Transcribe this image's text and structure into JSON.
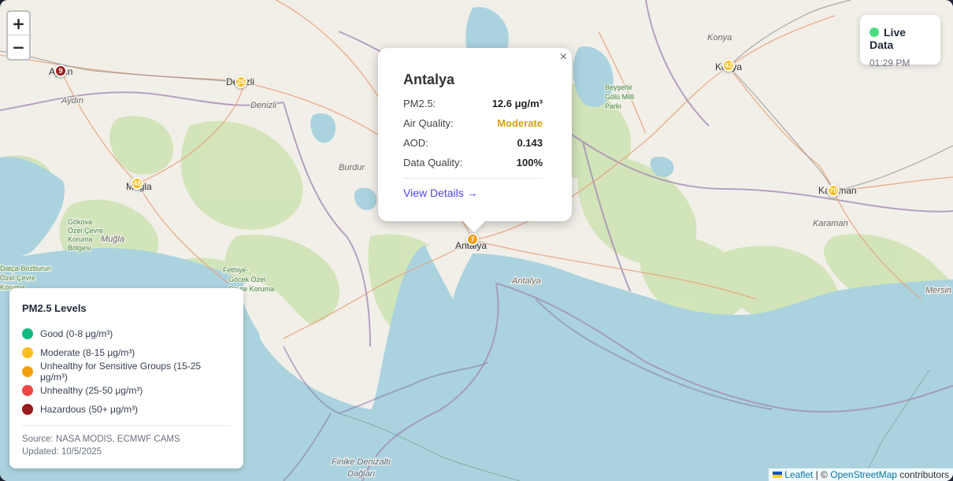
{
  "map": {
    "place_labels": [
      {
        "text": "Aydın",
        "size": 12,
        "color": "#333"
      },
      {
        "text": "Aydın",
        "size": 11,
        "color": "#6b6b6b",
        "italic": true
      },
      {
        "text": "Denizli",
        "size": 12,
        "color": "#333"
      },
      {
        "text": "Denizli",
        "size": 11,
        "color": "#6b6b6b",
        "italic": true
      },
      {
        "text": "Konya",
        "size": 11,
        "color": "#6b6b6b",
        "italic": true
      },
      {
        "text": "Konya",
        "size": 12,
        "color": "#333"
      },
      {
        "text": "Beyşehir",
        "size": 9,
        "color": "#3f8a3f"
      },
      {
        "text": "Gölü Milli",
        "size": 9,
        "color": "#3f8a3f"
      },
      {
        "text": "Parkı",
        "size": 9,
        "color": "#3f8a3f"
      },
      {
        "text": "Burdur",
        "size": 11,
        "color": "#6b6b6b",
        "italic": true
      },
      {
        "text": "Muğla",
        "size": 12,
        "color": "#333"
      },
      {
        "text": "Muğla",
        "size": 11,
        "color": "#6b6b6b",
        "italic": true
      },
      {
        "text": "Gökova",
        "size": 9,
        "color": "#3f8a3f"
      },
      {
        "text": "Özel Çevre",
        "size": 9,
        "color": "#3f8a3f"
      },
      {
        "text": "Koruma",
        "size": 9,
        "color": "#3f8a3f"
      },
      {
        "text": "Bölgesi",
        "size": 9,
        "color": "#3f8a3f"
      },
      {
        "text": "Fethiye-",
        "size": 9,
        "color": "#3f8a3f"
      },
      {
        "text": "Göcek Özel",
        "size": 9,
        "color": "#3f8a3f"
      },
      {
        "text": "Çevre Koruma",
        "size": 9,
        "color": "#3f8a3f"
      },
      {
        "text": "Datça-Bozburun",
        "size": 9,
        "color": "#3f8a3f"
      },
      {
        "text": "Özel Çevre",
        "size": 9,
        "color": "#3f8a3f"
      },
      {
        "text": "Koruma",
        "size": 9,
        "color": "#3f8a3f"
      },
      {
        "text": "Antalya",
        "size": 12,
        "color": "#333"
      },
      {
        "text": "Antalya",
        "size": 11,
        "color": "#6b6b6b",
        "italic": true
      },
      {
        "text": "Karaman",
        "size": 12,
        "color": "#333"
      },
      {
        "text": "Karaman",
        "size": 11,
        "color": "#6b6b6b",
        "italic": true
      },
      {
        "text": "Mersin",
        "size": 11,
        "color": "#6b6b6b",
        "italic": true
      },
      {
        "text": "Finike Denizaltı",
        "size": 11,
        "color": "#4a6a80",
        "italic": true
      },
      {
        "text": "Dağları",
        "size": 11,
        "color": "#4a6a80",
        "italic": true
      }
    ],
    "markers": [
      {
        "value": "9",
        "color": "#991b1b"
      },
      {
        "value": "26",
        "color": "#fbbf24"
      },
      {
        "value": "48",
        "color": "#fbbf24"
      },
      {
        "value": "42",
        "color": "#fbbf24"
      },
      {
        "value": "70",
        "color": "#fbbf24"
      },
      {
        "value": "7",
        "color": "#f59e0b"
      }
    ]
  },
  "zoom": {
    "in": "+",
    "out": "−"
  },
  "live": {
    "title": "Live Data",
    "time": "01:29 PM",
    "dot_color": "#4ade80"
  },
  "popup": {
    "city": "Antalya",
    "close": "×",
    "rows": [
      {
        "label": "PM2.5:",
        "value": "12.6 μg/m³",
        "color": "#222"
      },
      {
        "label": "Air Quality:",
        "value": "Moderate",
        "color": "#d4a017"
      },
      {
        "label": "AOD:",
        "value": "0.143",
        "color": "#222"
      },
      {
        "label": "Data Quality:",
        "value": "100%",
        "color": "#222"
      }
    ],
    "link": "View Details →"
  },
  "legend": {
    "title": "PM2.5 Levels",
    "items": [
      {
        "label": "Good (0-8 μg/m³)",
        "color": "#10b981"
      },
      {
        "label": "Moderate (8-15 μg/m³)",
        "color": "#fbbf24"
      },
      {
        "label": "Unhealthy for Sensitive Groups (15-25 μg/m³)",
        "color": "#f59e0b"
      },
      {
        "label": "Unhealthy (25-50 μg/m³)",
        "color": "#ef4444"
      },
      {
        "label": "Hazardous (50+ μg/m³)",
        "color": "#991b1b"
      }
    ],
    "source": "Source: NASA MODIS, ECMWF CAMS",
    "updated": "Updated: 10/5/2025"
  },
  "attribution": {
    "leaflet": "Leaflet",
    "sep": "| ©",
    "osm": "OpenStreetMap",
    "rest": "contributors"
  }
}
